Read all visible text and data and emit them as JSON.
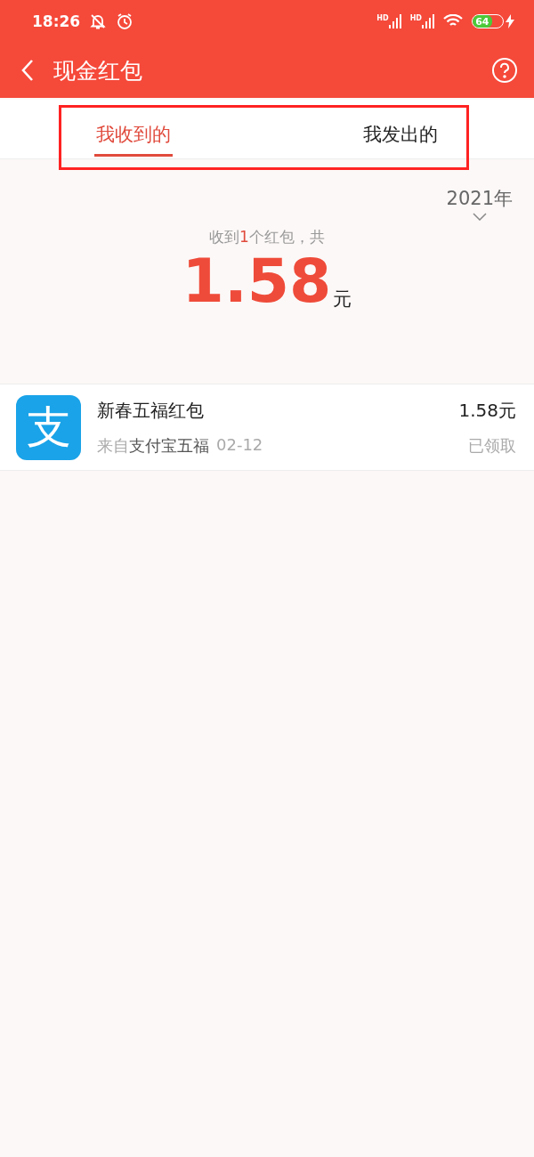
{
  "status_bar": {
    "time": "18:26",
    "network_label_1": "HD",
    "network_label_2": "HD",
    "battery_text": "64"
  },
  "header": {
    "title": "现金红包"
  },
  "tabs": [
    {
      "label": "我收到的",
      "selected": true
    },
    {
      "label": "我发出的",
      "selected": false
    }
  ],
  "annotation": {
    "kind": "highlight"
  },
  "year_filter": {
    "label": "2021年"
  },
  "summary": {
    "before": "收到",
    "count": "1",
    "after": "个红包，共",
    "amount": "1.58",
    "unit": "元"
  },
  "items": [
    {
      "logo_text": "支",
      "title": "新春五福红包",
      "source_prefix": "来自",
      "source": "支付宝五福",
      "date": "02-12",
      "amount": "1.58元",
      "status": "已领取"
    }
  ]
}
